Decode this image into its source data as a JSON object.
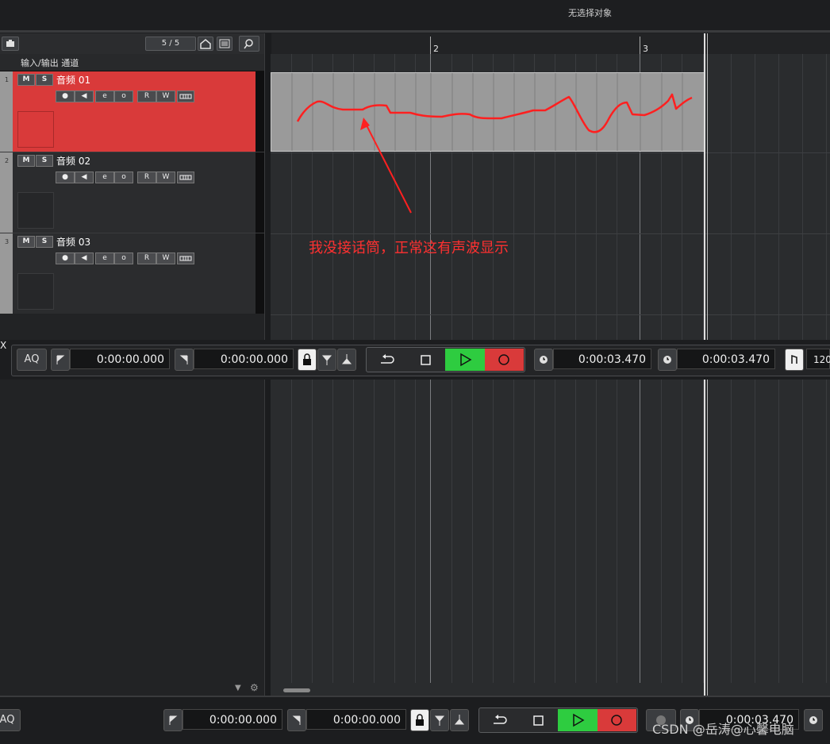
{
  "topbar": {
    "status": "无选择对象"
  },
  "toolbar": {
    "track_count": "5 / 5"
  },
  "ruler": {
    "markers": [
      "2",
      "3"
    ]
  },
  "io_header": {
    "label": "输入/输出 通道"
  },
  "tracks": [
    {
      "number": "1",
      "name": "音频 01",
      "mute": "M",
      "solo": "S",
      "selected": true
    },
    {
      "number": "2",
      "name": "音频 02",
      "mute": "M",
      "solo": "S",
      "selected": false
    },
    {
      "number": "3",
      "name": "音频 03",
      "mute": "M",
      "solo": "S",
      "selected": false
    }
  ],
  "track_controls": {
    "record": "●",
    "monitor": "◀",
    "edit": "e",
    "insert": "o",
    "read": "R",
    "write": "W"
  },
  "annotation": {
    "text": "我没接话筒，正常这有声波显示",
    "color": "#ff3030"
  },
  "transport_main": {
    "aq_label": "AQ",
    "left_locator": "0:00:00.000",
    "right_locator": "0:00:00.000",
    "primary_time": "0:00:03.470",
    "secondary_time": "0:00:03.470",
    "tempo": "120",
    "close_label": "X"
  },
  "transport_bottom": {
    "aq_label": "AQ",
    "left_locator": "0:00:00.000",
    "right_locator": "0:00:00.000",
    "primary_time": "0:00:03.470"
  },
  "colors": {
    "selected_track": "#d93a3a",
    "play": "#2ecc40",
    "record": "#d93a3a",
    "waveform": "#ff2020"
  },
  "watermark": {
    "text": "CSDN @岳涛@心馨电脑"
  }
}
